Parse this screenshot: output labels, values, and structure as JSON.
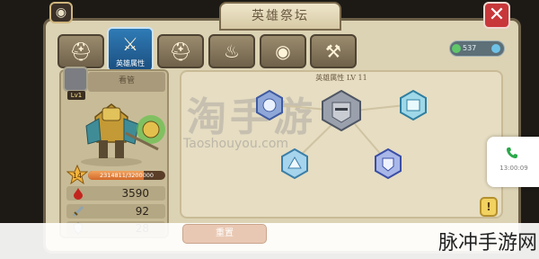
{
  "window": {
    "title": "英雄祭坛"
  },
  "tabs": [
    {
      "icon": "viking-helmet-icon",
      "label": ""
    },
    {
      "icon": "knight-helmet-icon",
      "label": "英雄属性"
    },
    {
      "icon": "horned-helmet-icon",
      "label": ""
    },
    {
      "icon": "flame-icon",
      "label": ""
    },
    {
      "icon": "sack-icon",
      "label": ""
    },
    {
      "icon": "hammer-icon",
      "label": ""
    }
  ],
  "resources": {
    "gem_value": "537"
  },
  "hero": {
    "name": "看管",
    "level_badge": "Lv1",
    "level": "14",
    "exp_text": "2314811/3200000",
    "exp_fraction": 0.723
  },
  "stats": [
    {
      "icon": "blood-drop-icon",
      "value": "3590"
    },
    {
      "icon": "sword-icon",
      "value": "92"
    },
    {
      "icon": "shield-icon",
      "value": "28"
    }
  ],
  "skill_tree": {
    "title": "英雄属性 LV 11"
  },
  "bottom_button": {
    "label": "重置"
  },
  "hint_button": {
    "label": "!"
  },
  "phone_widget": {
    "text": "13:00:09"
  },
  "watermark": {
    "big": "淘手游",
    "small": "Taoshouyou.com"
  },
  "banner": {
    "text": "脉冲手游网"
  },
  "colors": {
    "panel": "#dcd3b4",
    "active_tab": "#2f7bb6",
    "close": "#c8373a",
    "exp": "#d36a2a"
  }
}
